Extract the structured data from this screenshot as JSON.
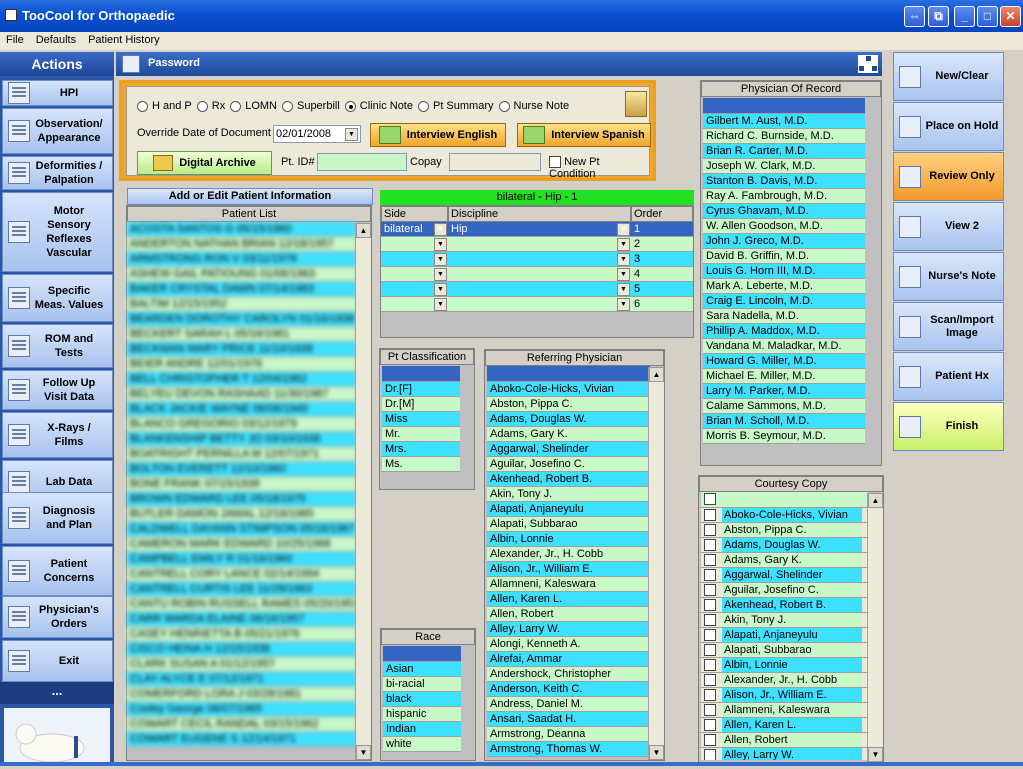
{
  "window": {
    "title": "TooCool for Orthopaedic"
  },
  "menu": [
    "File",
    "Defaults",
    "Patient History"
  ],
  "actions": {
    "header": "Actions",
    "items": [
      "HPI",
      "Observation/\nAppearance",
      "Deformities /\nPalpation",
      "Motor\nSensory\nReflexes\nVascular",
      "Specific\nMeas. Values",
      "ROM and\nTests",
      "Follow Up\nVisit Data",
      "X-Rays /\nFilms",
      "Lab Data",
      "Diagnosis\nand Plan",
      "Patient\nConcerns",
      "Physician's\nOrders",
      "Exit"
    ],
    "more": "..."
  },
  "right_actions": [
    "New/Clear",
    "Place on Hold",
    "Review Only",
    "View 2",
    "Nurse's Note",
    "Scan/Import\nImage",
    "Patient Hx",
    "Finish"
  ],
  "password_tab": "Password",
  "doc_types": [
    "H and P",
    "Rx",
    "LOMN",
    "Superbill",
    "Clinic Note",
    "Pt Summary",
    "Nurse Note"
  ],
  "doc_type_selected": "Clinic Note",
  "override_label": "Override Date of Document",
  "override_date": "02/01/2008",
  "interview_english": "Interview English",
  "interview_spanish": "Interview Spanish",
  "digital_archive": "Digital Archive",
  "ptid_label": "Pt. ID#",
  "copay_label": "Copay",
  "new_pt_condition": "New Pt Condition",
  "add_edit_patient": "Add or Edit Patient Information",
  "patient_list_header": "Patient List",
  "patient_list": [
    "ACOSTA SANTOS G 05/15/1960",
    "ANDERTON NATHAN BRIAN 12/18/1957",
    "ARMSTRONG RON V 03/11/1978",
    "ASHEW GAIL PATIOUNG 01/06/1963",
    "BAKER CRYSTAL DAWN 07/14/1983",
    "BALTIM 12/15/1952",
    "BEARDEN DOROTHY CAROLYN 01/16/1936",
    "BECKERT SARAH L 05/16/1981",
    "BECKMAN MARY PRICE 11/10/1938",
    "BEIER ANDRE 12/01/1976",
    "BELL CHRISTOPHER T 12/04/1962",
    "BELYEU DEVON RASHAAD 11/30/1987",
    "BLACK JACKIE WAYNE 06/06/1949",
    "BLANCO GREGORIO 03/12/1979",
    "BLANKENSHIP BETTY JO 03/10/1938",
    "BOATRIGHT PERNILLA M 12/07/1971",
    "BOLTON EVERETT 12/10/1960",
    "BONE FRANK 07/15/1939",
    "BROWN EDWARD LEE 05/18/1975",
    "BUTLER DAMON JAMAL 12/16/1985",
    "CALDWELL DAYANN STIMPSON 05/16/1967",
    "CAMERON MARK EDWARD 10/25/1968",
    "CAMPBELL EMILY R 01/16/1960",
    "CANTRELL CORY LANCE 02/14/1994",
    "CANTRELL CURTIS LEE 11/29/1963",
    "CANTU ROBIN RUSSELL RAMES 05/20/1951",
    "CARR WARDA ELAINE 06/16/1957",
    "CASEY HENRIETTA B 05/21/1976",
    "CISCO HEINA H 12/15/1938",
    "CLARK SUSAN A 01/12/1957",
    "CLAY ALYCE E 07/12/1971",
    "COMERFORD LORA J 03/28/1981",
    "Cooley George 06/07/1965",
    "COWART CECIL RANDAL 03/15/1962",
    "COWART EUGENE S 12/14/1971"
  ],
  "problem_header": "bilateral - Hip - 1",
  "problem_cols": [
    "Side",
    "Discipline",
    "Order"
  ],
  "problem_rows": [
    {
      "side": "bilateral",
      "discipline": "Hip",
      "order": "1"
    },
    {
      "side": "",
      "discipline": "",
      "order": "2"
    },
    {
      "side": "",
      "discipline": "",
      "order": "3"
    },
    {
      "side": "",
      "discipline": "",
      "order": "4"
    },
    {
      "side": "",
      "discipline": "",
      "order": "5"
    },
    {
      "side": "",
      "discipline": "",
      "order": "6"
    }
  ],
  "pt_class_header": "Pt Classification",
  "pt_classes": [
    "Dr.[F]",
    "Dr.[M]",
    "Miss",
    "Mr.",
    "Mrs.",
    "Ms."
  ],
  "race_header": "Race",
  "races": [
    "Asian",
    "bi-racial",
    "black",
    "hispanic",
    "Indian",
    "white"
  ],
  "referring_header": "Referring Physician",
  "referring": [
    "Aboko-Cole-Hicks, Vivian",
    "Abston, Pippa C.",
    "Adams, Douglas W.",
    "Adams, Gary K.",
    "Aggarwal, Shelinder",
    "Aguilar, Josefino C.",
    "Akenhead, Robert B.",
    "Akin, Tony J.",
    "Alapati, Anjaneyulu",
    "Alapati, Subbarao",
    "Albin, Lonnie",
    "Alexander, Jr., H. Cobb",
    "Alison, Jr., William E.",
    "Allamneni, Kaleswara",
    "Allen, Karen L.",
    "Allen, Robert",
    "Alley, Larry W.",
    "Alongi, Kenneth A.",
    "Alrefai, Ammar",
    "Andershock, Christopher",
    "Anderson, Keith C.",
    "Andress, Daniel M.",
    "Ansari, Saadat H.",
    "Armstrong, Deanna",
    "Armstrong, Thomas W."
  ],
  "por_header": "Physician Of Record",
  "physicians": [
    "Gilbert M. Aust, M.D.",
    "Richard C. Burnside, M.D.",
    "Brian R. Carter, M.D.",
    "Joseph W. Clark, M.D.",
    "Stanton B. Davis, M.D.",
    "Ray A. Fambrough, M.D.",
    "Cyrus Ghavam, M.D.",
    "W. Allen Goodson, M.D.",
    "John J. Greco, M.D.",
    "David B. Griffin, M.D.",
    "Louis G. Horn III, M.D.",
    "Mark A. Leberte, M.D.",
    "Craig E. Lincoln, M.D.",
    "Sara Nadella, M.D.",
    "Phillip A. Maddox, M.D.",
    "Vandana M. Maladkar, M.D.",
    "Howard G. Miller, M.D.",
    "Michael E. Miller, M.D.",
    "Larry M. Parker, M.D.",
    "Calame Sammons, M.D.",
    "Brian M. Scholl, M.D.",
    "Morris B. Seymour, M.D."
  ],
  "courtesy_header": "Courtesy Copy",
  "courtesy": [
    "Aboko-Cole-Hicks, Vivian",
    "Abston, Pippa C.",
    "Adams, Douglas W.",
    "Adams, Gary K.",
    "Aggarwal, Shelinder",
    "Aguilar, Josefino C.",
    "Akenhead, Robert B.",
    "Akin, Tony J.",
    "Alapati, Anjaneyulu",
    "Alapati, Subbarao",
    "Albin, Lonnie",
    "Alexander, Jr., H. Cobb",
    "Alison, Jr., William E.",
    "Allamneni, Kaleswara",
    "Allen, Karen L.",
    "Allen, Robert",
    "Alley, Larry W."
  ],
  "colors": {
    "cyan": "#3fe0ff",
    "green": "#c8f7c8",
    "selected": "#3465c2",
    "accent": "#f2a52a"
  }
}
